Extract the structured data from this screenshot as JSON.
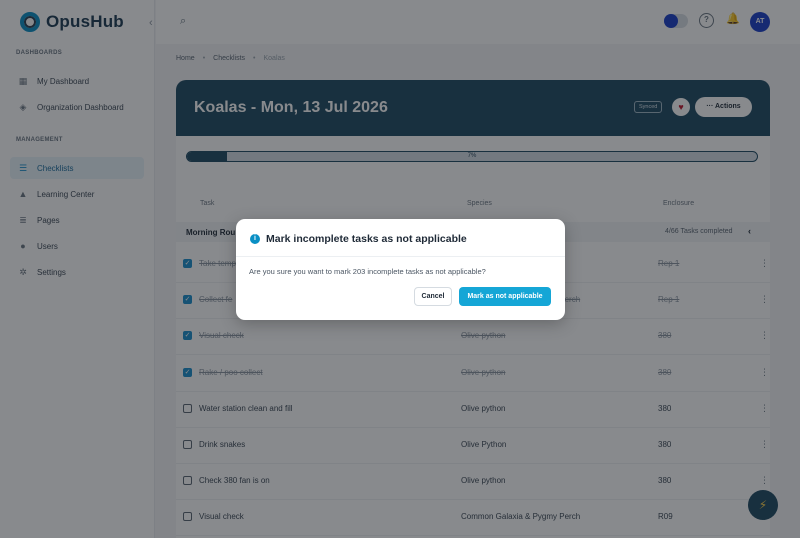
{
  "app": {
    "name": "OpusHub"
  },
  "sidebar": {
    "collapse_glyph": "‹",
    "sections": [
      {
        "label": "DASHBOARDS"
      },
      {
        "label": "MANAGEMENT"
      }
    ],
    "items": [
      {
        "label": "My Dashboard",
        "icon": "dashboard-icon"
      },
      {
        "label": "Organization Dashboard",
        "icon": "organization-icon"
      },
      {
        "label": "Checklists",
        "icon": "checklist-icon",
        "active": true
      },
      {
        "label": "Learning Center",
        "icon": "graduation-cap-icon"
      },
      {
        "label": "Pages",
        "icon": "pages-icon"
      },
      {
        "label": "Users",
        "icon": "users-icon"
      },
      {
        "label": "Settings",
        "icon": "gear-icon"
      }
    ]
  },
  "topbar": {
    "avatar_initials": "AT"
  },
  "breadcrumb": [
    "Home",
    "Checklists",
    "Koalas"
  ],
  "header": {
    "title": "Koalas - Mon, 13 Jul 2026",
    "status_badge": "Synced",
    "actions_label": "··· Actions"
  },
  "progress": {
    "value_pct": 7,
    "label": "7%"
  },
  "table": {
    "columns": [
      "Task",
      "Species",
      "Enclosure"
    ],
    "group": {
      "name": "Morning Rou",
      "count_label": "4/66 Tasks completed"
    },
    "rows": [
      {
        "task": "Take temp",
        "species": "",
        "enclosure": "Rep 1",
        "done": true
      },
      {
        "task": "Collect fe",
        "species": "Common Galaxia & Pygmy Perch",
        "enclosure": "Rep 1",
        "done": true
      },
      {
        "task": "Visual check",
        "species": "Olive python",
        "enclosure": "380",
        "done": true
      },
      {
        "task": "Rake / poo collect",
        "species": "Olive python",
        "enclosure": "380",
        "done": true
      },
      {
        "task": "Water station clean and fill",
        "species": "Olive python",
        "enclosure": "380",
        "done": false
      },
      {
        "task": "Drink snakes",
        "species": "Olive Python",
        "enclosure": "380",
        "done": false
      },
      {
        "task": "Check 380 fan is on",
        "species": "Olive python",
        "enclosure": "380",
        "done": false
      },
      {
        "task": "Visual check",
        "species": "Common Galaxia & Pygmy Perch",
        "enclosure": "R09",
        "done": false
      }
    ]
  },
  "dialog": {
    "title": "Mark incomplete tasks as not applicable",
    "body": "Are you sure you want to mark 203 incomplete tasks as not applicable?",
    "cancel_label": "Cancel",
    "confirm_label": "Mark as not applicable",
    "icon": "info-icon"
  },
  "colors": {
    "accent": "#15a6d6",
    "header_bg": "#1f4a63",
    "brand_blue": "#1b3fc9"
  }
}
